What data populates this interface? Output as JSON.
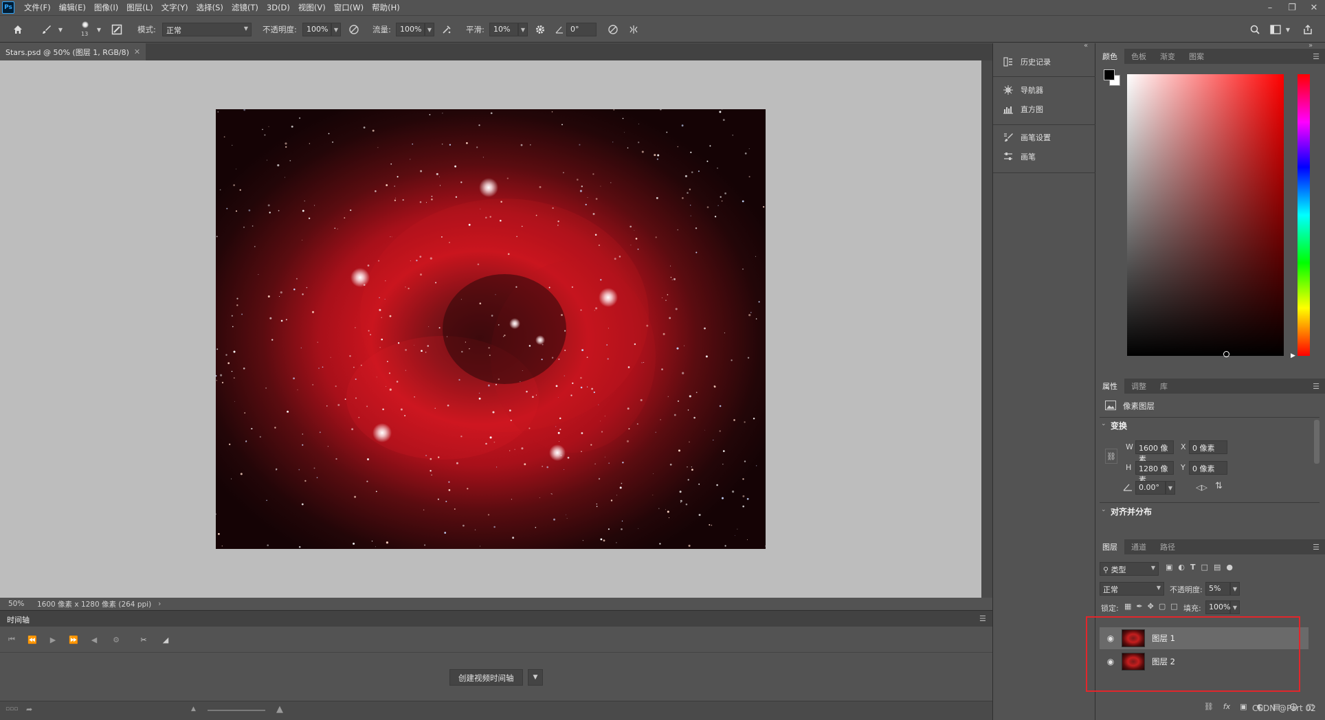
{
  "menubar": {
    "app_logo": "Ps",
    "items": [
      "文件(F)",
      "编辑(E)",
      "图像(I)",
      "图层(L)",
      "文字(Y)",
      "选择(S)",
      "滤镜(T)",
      "3D(D)",
      "视图(V)",
      "窗口(W)",
      "帮助(H)"
    ]
  },
  "options_bar": {
    "brush_size": "13",
    "mode_label": "模式:",
    "mode_value": "正常",
    "opacity_label": "不透明度:",
    "opacity_value": "100%",
    "flow_label": "流量:",
    "flow_value": "100%",
    "smoothing_label": "平滑:",
    "smoothing_value": "10%",
    "angle_value": "0°"
  },
  "document": {
    "tab_title": "Stars.psd @ 50% (图层 1, RGB/8)",
    "zoom": "50%",
    "info": "1600 像素 x 1280 像素 (264 ppi)"
  },
  "timeline": {
    "title": "时间轴",
    "create_button": "创建视频时间轴"
  },
  "dock": {
    "items": [
      "历史记录",
      "导航器",
      "直方图",
      "画笔设置",
      "画笔"
    ]
  },
  "color_panel": {
    "tabs": [
      "颜色",
      "色板",
      "渐变",
      "图案"
    ],
    "foreground": "#000000",
    "background": "#ffffff",
    "hue_color": "#ff0000"
  },
  "properties_panel": {
    "tabs": [
      "属性",
      "调整",
      "库"
    ],
    "layer_type": "像素图层",
    "transform_title": "变换",
    "w_label": "W",
    "w_value": "1600 像素",
    "h_label": "H",
    "h_value": "1280 像素",
    "x_label": "X",
    "x_value": "0 像素",
    "y_label": "Y",
    "y_value": "0 像素",
    "angle_value": "0.00°",
    "align_title": "对齐并分布"
  },
  "layers_panel": {
    "tabs": [
      "图层",
      "通道",
      "路径"
    ],
    "filter_kind": "类型",
    "blend_mode": "正常",
    "opacity_label": "不透明度:",
    "opacity_value": "5%",
    "lock_label": "锁定:",
    "fill_label": "填充:",
    "fill_value": "100%",
    "layers": [
      {
        "name": "图层 1",
        "visible": true,
        "selected": true
      },
      {
        "name": "图层 2",
        "visible": true,
        "selected": false
      }
    ]
  },
  "watermark": "CSDN @Part 02",
  "accent_color": "#e3262b"
}
